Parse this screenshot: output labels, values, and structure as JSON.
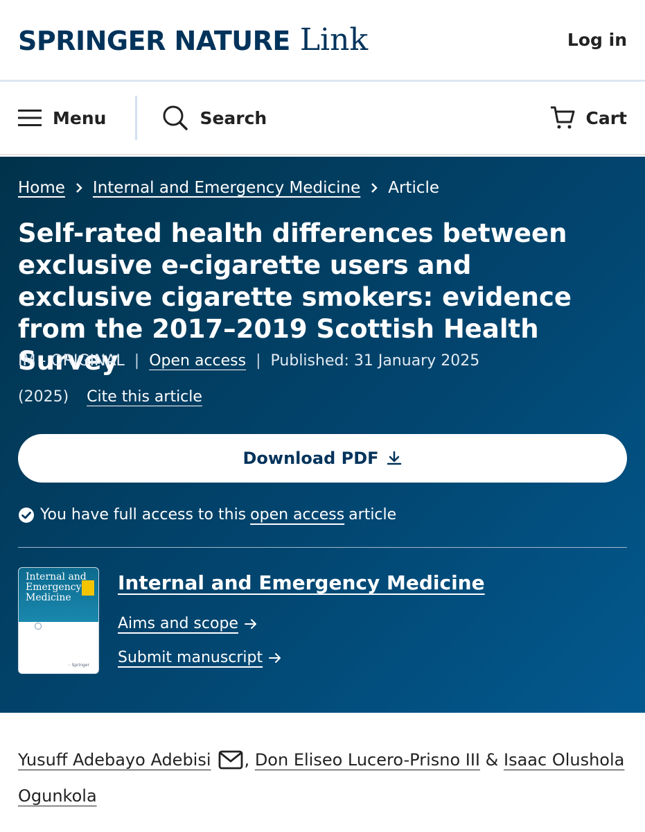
{
  "header": {
    "logo_brand": "SPRINGER NATURE",
    "logo_product": "Link",
    "login_label": "Log in"
  },
  "nav": {
    "menu_label": "Menu",
    "search_label": "Search",
    "cart_label": "Cart"
  },
  "breadcrumb": {
    "items": [
      "Home",
      "Internal and Emergency Medicine",
      "Article"
    ]
  },
  "article": {
    "title": "Self-rated health differences between exclusive e-cigarette users and exclusive cigarette smokers: evidence from the 2017–2019 Scottish Health Survey",
    "type": "IM - ORIGINAL",
    "open_access": "Open access",
    "published": "Published: 31 January 2025",
    "year": "(2025)",
    "cite_label": "Cite this article",
    "download_label": "Download PDF",
    "access_prefix": "You have full access to this",
    "access_link": "open access",
    "access_suffix": "article"
  },
  "journal": {
    "name": "Internal and Emergency Medicine",
    "cover_title": "Internal and Emergency Medicine",
    "aims_label": "Aims and scope",
    "submit_label": "Submit manuscript"
  },
  "authors": {
    "a1": "Yusuff Adebayo Adebisi",
    "comma": ",",
    "a2": "Don Eliseo Lucero-Prisno III",
    "amp": "&",
    "a3": "Isaac Olushola Ogunkola"
  },
  "colors": {
    "brand_navy": "#02335b",
    "hero_dark": "#01324b",
    "hero_light": "#03598f"
  }
}
